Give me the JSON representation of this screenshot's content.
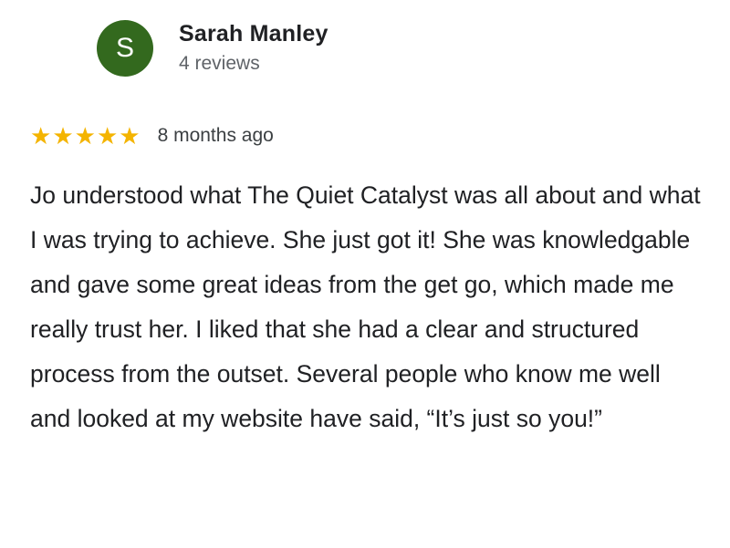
{
  "review": {
    "author_initial": "S",
    "author_name": "Sarah Manley",
    "author_reviews": "4 reviews",
    "rating": 5,
    "rating_max": 5,
    "time_ago": "8 months ago",
    "text": "Jo understood what The Quiet Catalyst was all about and what I was trying to achieve. She just got it! She was knowledgable and gave some great ideas from the get go, which made me really trust her. I liked that she had a clear and structured process from the outset. Several people who know me well and looked at my website have said, “It’s just so you!”"
  },
  "colors": {
    "avatar_bg": "#33691e",
    "star_fill": "#f4b400",
    "name_text": "#202124",
    "meta_text": "#5f6368"
  },
  "icons": {
    "star": "star-icon"
  }
}
